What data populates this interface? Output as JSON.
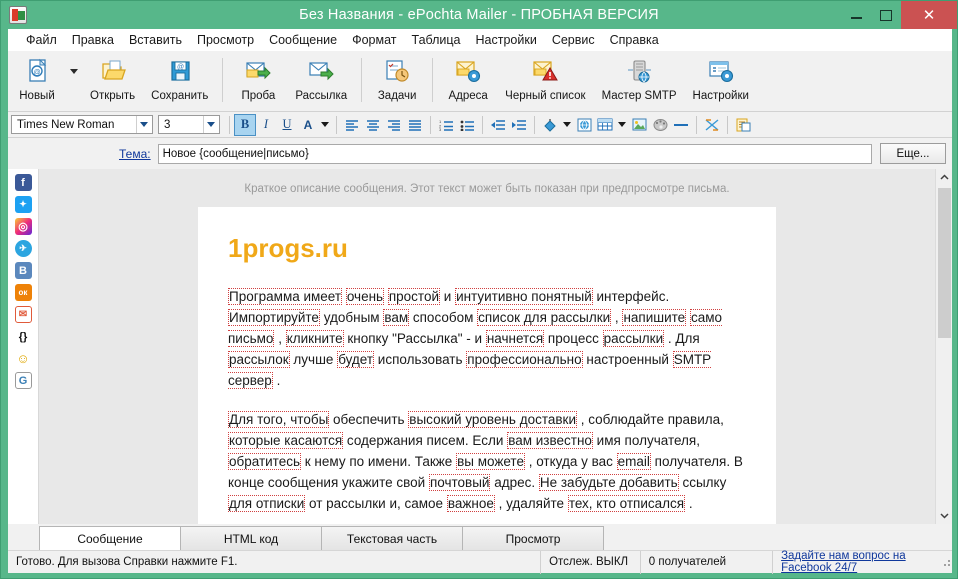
{
  "titlebar": {
    "title": "Без Названия - ePochta Mailer - ПРОБНАЯ ВЕРСИЯ",
    "minimize": "–",
    "maximize": "□",
    "close": "✕",
    "bg_color": "#57b78a",
    "close_color": "#cb5252"
  },
  "menubar": {
    "items": [
      {
        "label": "Файл"
      },
      {
        "label": "Правка"
      },
      {
        "label": "Вставить"
      },
      {
        "label": "Просмотр"
      },
      {
        "label": "Сообщение"
      },
      {
        "label": "Формат"
      },
      {
        "label": "Таблица"
      },
      {
        "label": "Настройки"
      },
      {
        "label": "Сервис"
      },
      {
        "label": "Справка"
      }
    ]
  },
  "toolbar": {
    "buttons": [
      {
        "label": "Новый",
        "icon": "new-document-icon",
        "has_dropdown": true
      },
      {
        "label": "Открыть",
        "icon": "open-folder-icon",
        "has_dropdown": false
      },
      {
        "label": "Сохранить",
        "icon": "save-disk-icon",
        "has_dropdown": false
      },
      {
        "label": "Проба",
        "icon": "test-send-icon",
        "has_dropdown": false
      },
      {
        "label": "Рассылка",
        "icon": "mailing-send-icon",
        "has_dropdown": false
      },
      {
        "label": "Задачи",
        "icon": "tasks-clock-icon",
        "has_dropdown": false
      },
      {
        "label": "Адреса",
        "icon": "addresses-gear-icon",
        "has_dropdown": false
      },
      {
        "label": "Черный список",
        "icon": "blacklist-warning-icon",
        "has_dropdown": false
      },
      {
        "label": "Мастер SMTP",
        "icon": "smtp-server-icon",
        "has_dropdown": false
      },
      {
        "label": "Настройки",
        "icon": "settings-gear-icon",
        "has_dropdown": false
      }
    ]
  },
  "formatbar": {
    "font_family": {
      "value": "Times New Roman",
      "placeholder": "Times New Roman"
    },
    "font_size": {
      "value": "3",
      "placeholder": "3"
    },
    "bold": "B",
    "italic": "I",
    "underline": "U",
    "font_color": "A",
    "buttons": [
      {
        "name": "align-left-icon"
      },
      {
        "name": "align-center-icon"
      },
      {
        "name": "align-right-icon"
      },
      {
        "name": "align-justify-icon"
      },
      {
        "name": "numbered-list-icon"
      },
      {
        "name": "bulleted-list-icon"
      },
      {
        "name": "outdent-icon"
      },
      {
        "name": "indent-icon"
      },
      {
        "name": "fill-color-icon"
      },
      {
        "name": "insert-link-icon"
      },
      {
        "name": "insert-table-icon"
      },
      {
        "name": "insert-image-icon"
      },
      {
        "name": "palette-icon"
      },
      {
        "name": "horizontal-rule-icon"
      },
      {
        "name": "clear-formatting-icon"
      },
      {
        "name": "paste-template-icon"
      }
    ]
  },
  "subject": {
    "label": "Тема:",
    "value": "Новое {сообщение|письмо}",
    "placeholder": "Новое {сообщение|письмо}",
    "more_button": "Еще..."
  },
  "social_sidebar": {
    "items": [
      {
        "name": "facebook-icon",
        "glyph": "f",
        "color": "#3b5998"
      },
      {
        "name": "twitter-icon",
        "glyph": "🐦",
        "color": "#1da1f2"
      },
      {
        "name": "instagram-icon",
        "glyph": "◎",
        "color": "#c13584"
      },
      {
        "name": "telegram-icon",
        "glyph": "✈",
        "color": "#2ca5e0"
      },
      {
        "name": "vk-icon",
        "glyph": "B",
        "color": "#5b88bd"
      },
      {
        "name": "odnoklassniki-icon",
        "glyph": "ок",
        "color": "#ee8208"
      },
      {
        "name": "email-icon",
        "glyph": "✉",
        "color": "#e05a3a"
      },
      {
        "name": "code-braces-icon",
        "glyph": "{}",
        "color": "#ffffff"
      },
      {
        "name": "smiley-icon",
        "glyph": "☺",
        "color": "#f5c518"
      },
      {
        "name": "google-icon",
        "glyph": "G",
        "color": "#ffffff"
      }
    ]
  },
  "editor": {
    "preheader": "Краткое описание сообщения. Этот текст может быть показан при предпросмотре письма.",
    "brand": "1progs.ru",
    "brand_color": "#f0a818",
    "paragraph1": [
      {
        "text": "Программа имеет",
        "spell": true
      },
      {
        "text": " ",
        "spell": false
      },
      {
        "text": "очень",
        "spell": true
      },
      {
        "text": " ",
        "spell": false
      },
      {
        "text": "простой",
        "spell": true
      },
      {
        "text": " и ",
        "spell": false
      },
      {
        "text": "интуитивно понятный",
        "spell": true
      },
      {
        "text": " интерфейс. ",
        "spell": false
      },
      {
        "text": "Импортируйте",
        "spell": true
      },
      {
        "text": " удобным ",
        "spell": false
      },
      {
        "text": "вам",
        "spell": true
      },
      {
        "text": " способом ",
        "spell": false
      },
      {
        "text": "список для рассылки",
        "spell": true
      },
      {
        "text": " , ",
        "spell": false
      },
      {
        "text": "напишите",
        "spell": true
      },
      {
        "text": " ",
        "spell": false
      },
      {
        "text": "само письмо",
        "spell": true
      },
      {
        "text": " , ",
        "spell": false
      },
      {
        "text": "кликните",
        "spell": true
      },
      {
        "text": " кнопку \"Рассылка\" - и ",
        "spell": false
      },
      {
        "text": "начнется",
        "spell": true
      },
      {
        "text": " процесс ",
        "spell": false
      },
      {
        "text": "рассылки",
        "spell": true
      },
      {
        "text": " . Для ",
        "spell": false
      },
      {
        "text": "рассылок",
        "spell": true
      },
      {
        "text": " лучше ",
        "spell": false
      },
      {
        "text": "будет",
        "spell": true
      },
      {
        "text": " использовать ",
        "spell": false
      },
      {
        "text": "профессионально",
        "spell": true
      },
      {
        "text": " настроенный ",
        "spell": false
      },
      {
        "text": "SMTP сервер",
        "spell": true
      },
      {
        "text": " .",
        "spell": false
      }
    ],
    "paragraph2": [
      {
        "text": "Для того, чтобы",
        "spell": true
      },
      {
        "text": " обеспечить ",
        "spell": false
      },
      {
        "text": "высокий уровень доставки",
        "spell": true
      },
      {
        "text": " , соблюдайте правила, ",
        "spell": false
      },
      {
        "text": "которые касаются",
        "spell": true
      },
      {
        "text": " содержания писем. Если ",
        "spell": false
      },
      {
        "text": "вам известно",
        "spell": true
      },
      {
        "text": " имя получателя, ",
        "spell": false
      },
      {
        "text": "обратитесь",
        "spell": true
      },
      {
        "text": " к нему по имени. Также ",
        "spell": false
      },
      {
        "text": "вы можете",
        "spell": true
      },
      {
        "text": " , откуда у вас ",
        "spell": false
      },
      {
        "text": "email",
        "spell": true
      },
      {
        "text": " получателя. В конце сообщения укажите свой ",
        "spell": false
      },
      {
        "text": "почтовый",
        "spell": true
      },
      {
        "text": "  адрес. ",
        "spell": false
      },
      {
        "text": "Не забудьте добавить",
        "spell": true
      },
      {
        "text": " ссылку ",
        "spell": false
      },
      {
        "text": "для отписки",
        "spell": true
      },
      {
        "text": " от рассылки и, самое ",
        "spell": false
      },
      {
        "text": "важное",
        "spell": true
      },
      {
        "text": " , удаляйте ",
        "spell": false
      },
      {
        "text": "тех, кто отписался",
        "spell": true
      },
      {
        "text": " .",
        "spell": false
      }
    ]
  },
  "scrollbar": {
    "up_arrow": "⌃",
    "down_arrow": "⌄"
  },
  "tabs": [
    {
      "label": "Сообщение",
      "active": true
    },
    {
      "label": "HTML код",
      "active": false
    },
    {
      "label": "Текстовая часть",
      "active": false
    },
    {
      "label": "Просмотр",
      "active": false
    }
  ],
  "statusbar": {
    "message": "Готово. Для вызова Справки нажмите F1.",
    "tracking": "Отслеж. ВЫКЛ",
    "recipients": "0 получателей",
    "link": "Задайте нам вопрос на Facebook 24/7"
  }
}
